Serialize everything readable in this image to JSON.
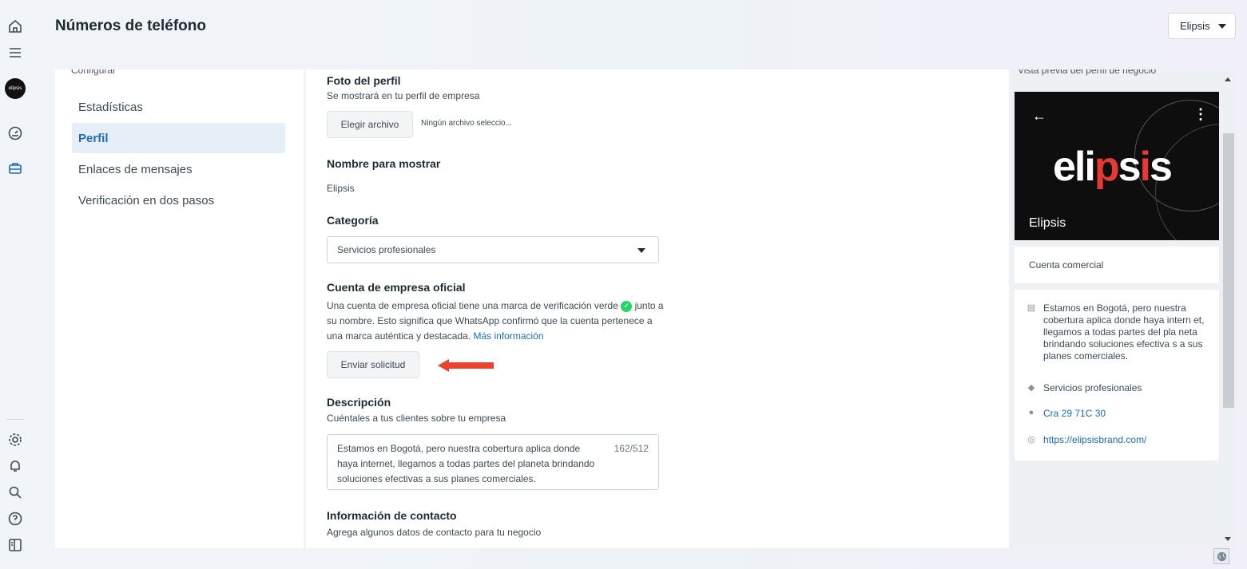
{
  "header": {
    "title": "Números de teléfono",
    "account": "Elipsis"
  },
  "rail": {
    "logo_text": "elipsis"
  },
  "nav": {
    "section_cut": "Configurar",
    "items": [
      {
        "label": "Estadísticas",
        "active": false
      },
      {
        "label": "Perfil",
        "active": true
      },
      {
        "label": "Enlaces de mensajes",
        "active": false
      },
      {
        "label": "Verificación en dos pasos",
        "active": false
      }
    ]
  },
  "form": {
    "photo": {
      "title": "Foto del perfil",
      "subtitle": "Se mostrará en tu perfil de empresa",
      "button": "Elegir archivo",
      "file_status": "Ningún archivo seleccio..."
    },
    "display_name": {
      "title": "Nombre para mostrar",
      "value": "Elipsis"
    },
    "category": {
      "title": "Categoría",
      "selected": "Servicios profesionales"
    },
    "official": {
      "title": "Cuenta de empresa oficial",
      "text_1": "Una cuenta de empresa oficial tiene una marca de verificación verde",
      "text_2": "junto a su nombre. Esto significa que WhatsApp confirmó que la cuenta pertenece a una marca auténtica y destacada.",
      "link": "Más información",
      "button": "Enviar solicitud"
    },
    "description": {
      "title": "Descripción",
      "subtitle": "Cuéntales a tus clientes sobre tu empresa",
      "value": "Estamos en Bogotá, pero nuestra cobertura aplica donde haya internet, llegamos a todas partes del planeta brindando soluciones efectivas a sus planes comerciales.",
      "counter": "162/512"
    },
    "contact": {
      "title": "Información de contacto",
      "subtitle": "Agrega algunos datos de contacto para tu negocio"
    }
  },
  "preview": {
    "heading_cut": "Vista previa del perfil de negocio",
    "brand": {
      "pre": "eli",
      "mark": "p",
      "mid": "s",
      "mark2": "i",
      "post": "s"
    },
    "name": "Elipsis",
    "account_type": "Cuenta comercial",
    "details": [
      {
        "icon": "store-icon",
        "text": "Estamos en Bogotá, pero nuestra cobertura aplica donde haya intern et, llegamos a todas partes del pla neta brindando soluciones efectiva s a sus planes comerciales."
      },
      {
        "icon": "tag-icon",
        "text": "Servicios profesionales"
      },
      {
        "icon": "location-icon",
        "text": "Cra 29 71C 30"
      },
      {
        "icon": "globe-icon",
        "text": "https://elipsisbrand.com/"
      }
    ]
  },
  "colors": {
    "accent": "#1e6bb8",
    "arrow": "#e8432e",
    "verified": "#25d366"
  }
}
